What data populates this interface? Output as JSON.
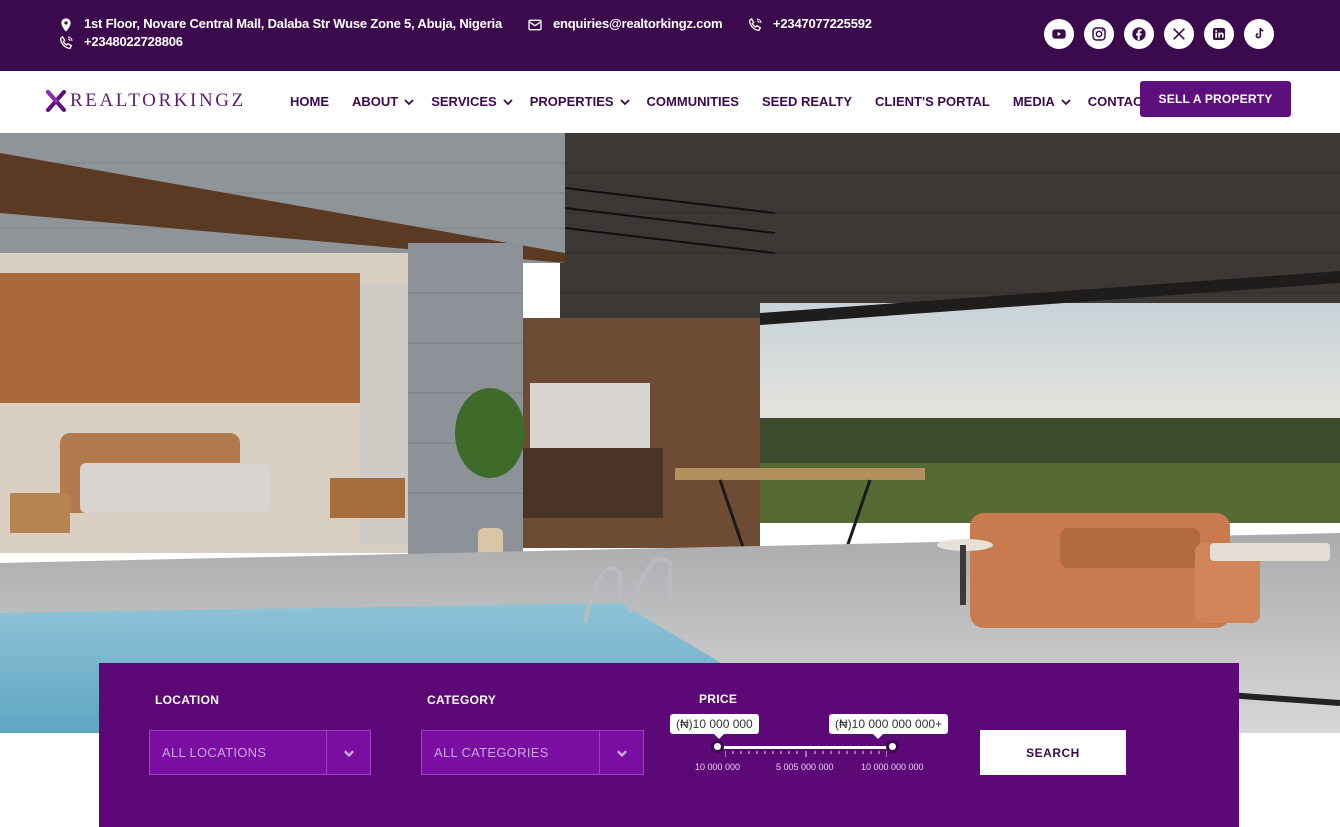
{
  "topbar": {
    "address": "1st Floor, Novare Central Mall, Dalaba Str Wuse Zone 5, Abuja, Nigeria",
    "phone_secondary": "+2348022728806",
    "email": "enquiries@realtorkingz.com",
    "phone_primary": "+2347077225592",
    "socials": [
      "youtube-icon",
      "instagram-icon",
      "facebook-icon",
      "x-icon",
      "linkedin-icon",
      "tiktok-icon"
    ]
  },
  "brand": {
    "name": "REALTORKINGZ",
    "color": "#5d0f7d"
  },
  "nav": {
    "items": [
      {
        "label": "HOME",
        "dropdown": false
      },
      {
        "label": "ABOUT",
        "dropdown": true
      },
      {
        "label": "SERVICES",
        "dropdown": true
      },
      {
        "label": "PROPERTIES",
        "dropdown": true
      },
      {
        "label": "COMMUNITIES",
        "dropdown": false
      },
      {
        "label": "SEED REALTY",
        "dropdown": false
      },
      {
        "label": "CLIENT'S PORTAL",
        "dropdown": false
      },
      {
        "label": "MEDIA",
        "dropdown": true
      },
      {
        "label": "CONTACT",
        "dropdown": false
      }
    ],
    "cta": "SELL A PROPERTY"
  },
  "search": {
    "location_label": "LOCATION",
    "location_value": "ALL LOCATIONS",
    "category_label": "CATEGORY",
    "category_value": "ALL CATEGORIES",
    "price_label": "PRICE",
    "price_min": "(₦)10 000 000",
    "price_max": "(₦)10 000 000 000+",
    "scale_min": "10 000 000",
    "scale_mid": "5 005 000 000",
    "scale_max": "10 000 000 000",
    "button": "SEARCH"
  },
  "colors": {
    "topbar": "#3b0a4c",
    "panel": "#5d0877",
    "select": "#7a0ea2"
  }
}
